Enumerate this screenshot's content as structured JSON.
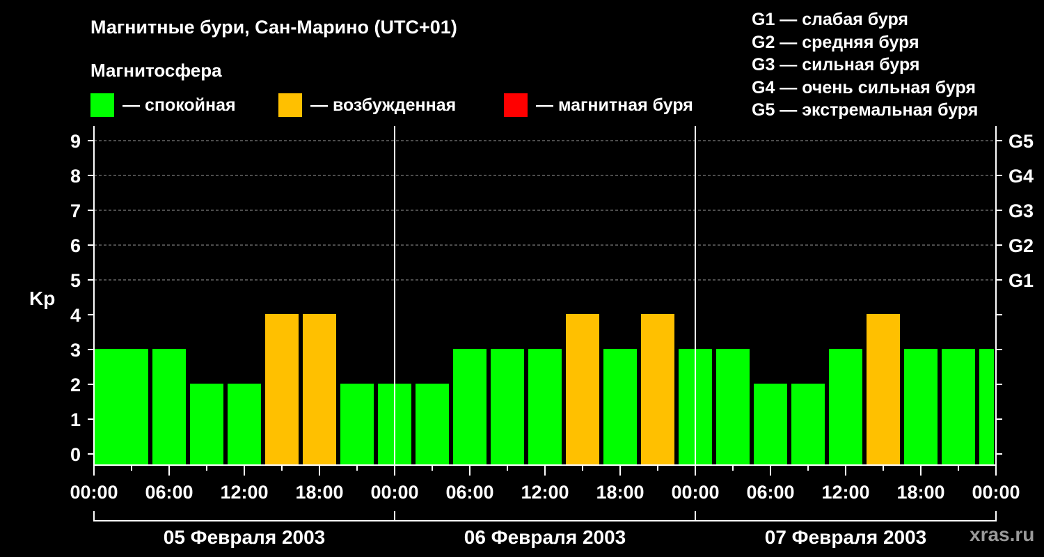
{
  "title": "Магнитные бури, Сан-Марино (UTC+01)",
  "subtitle": "Магнитосфера",
  "legend": [
    {
      "label": "— спокойная",
      "color": "#00ff00"
    },
    {
      "label": "— возбужденная",
      "color": "#ffc000"
    },
    {
      "label": "— магнитная буря",
      "color": "#ff0000"
    }
  ],
  "storm_scale": [
    "G1 — слабая буря",
    "G2 — средняя буря",
    "G3 — сильная буря",
    "G4 — очень сильная буря",
    "G5 — экстремальная буря"
  ],
  "watermark": "xras.ru",
  "chart_data": {
    "type": "bar",
    "ylabel": "Kp",
    "ylim": [
      0,
      9
    ],
    "yticks": [
      0,
      1,
      2,
      3,
      4,
      5,
      6,
      7,
      8,
      9
    ],
    "right_ticks": [
      {
        "value": 5,
        "label": "G1"
      },
      {
        "value": 6,
        "label": "G2"
      },
      {
        "value": 7,
        "label": "G3"
      },
      {
        "value": 8,
        "label": "G4"
      },
      {
        "value": 9,
        "label": "G5"
      }
    ],
    "grid": true,
    "xtick_labels": [
      "00:00",
      "06:00",
      "12:00",
      "18:00",
      "00:00",
      "06:00",
      "12:00",
      "18:00",
      "00:00",
      "06:00",
      "12:00",
      "18:00",
      "00:00"
    ],
    "days": [
      "05 Февраля 2003",
      "06 Февраля 2003",
      "07 Февраля 2003"
    ],
    "bar_hours": [
      1,
      3,
      6,
      9,
      12,
      15,
      18,
      21,
      24,
      27,
      30,
      33,
      36,
      39,
      42,
      45,
      48,
      51,
      54,
      57,
      60,
      63,
      66,
      69,
      72
    ],
    "values": [
      3,
      3,
      3,
      2,
      2,
      4,
      4,
      2,
      2,
      2,
      3,
      3,
      3,
      4,
      3,
      4,
      3,
      3,
      2,
      2,
      3,
      4,
      3,
      3,
      3
    ],
    "colors": {
      "quiet": "#00ff00",
      "active": "#ffc000",
      "storm": "#ff0000"
    }
  }
}
